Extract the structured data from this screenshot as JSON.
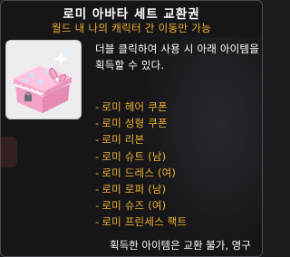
{
  "tooltip": {
    "title": "로미 아바타 세트 교환권",
    "subtitle": "월드 내 나의 캐릭터 간 이동만 가능",
    "icon": "pink-gift-box-icon",
    "description": "더블 클릭하여 사용 시 아래 아이템을 획득할 수 있다.",
    "items": [
      "로미 헤어 쿠폰",
      "로미 성형 쿠폰",
      "로미 리본",
      "로미 슈트 (남)",
      "로미 드레스 (여)",
      "로미 로퍼 (남)",
      "로미 슈즈 (여)",
      "로미 프린세스 팩트"
    ],
    "footer": "획득한 아이템은 교환 불가, 영구",
    "colors": {
      "title": "#ffffff",
      "subtitle": "#f0b030",
      "item": "#f0b030",
      "background": "#16161a"
    }
  }
}
